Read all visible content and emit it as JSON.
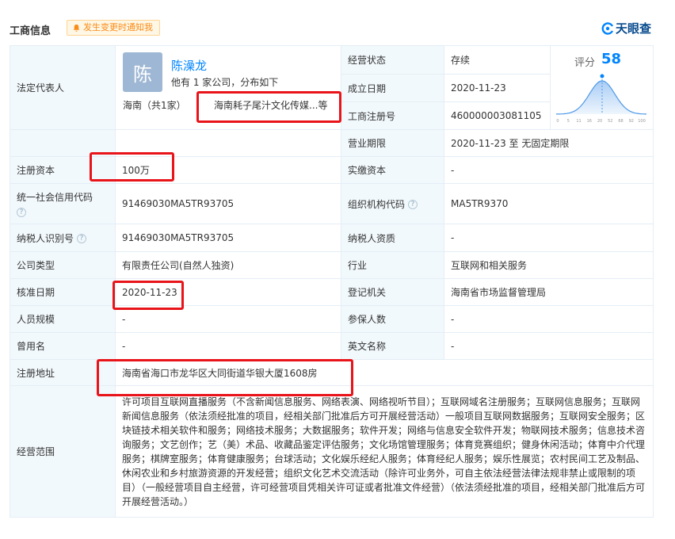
{
  "header": {
    "title": "工商信息",
    "notify_label": "发生变更时通知我",
    "brand_name": "天眼查"
  },
  "legal_rep": {
    "label": "法定代表人",
    "avatar_char": "陈",
    "name": "陈澡龙",
    "companies_text": "他有 1 家公司，分布如下",
    "region_text": "海南（共1家）",
    "company_text": "海南耗子尾汁文化传媒...等"
  },
  "score": {
    "label": "评分",
    "value": 58,
    "axis_ticks": [
      "0",
      "5",
      "11",
      "16",
      "20",
      "52",
      "68",
      "92",
      "100"
    ]
  },
  "fields": {
    "status_label": "经营状态",
    "status_value": "存续",
    "founded_label": "成立日期",
    "founded_value": "2020-11-23",
    "regno_label": "工商注册号",
    "regno_value": "460000003081105",
    "term_label": "营业期限",
    "term_value": "2020-11-23 至 无固定期限",
    "capital_label": "注册资本",
    "capital_value": "100万",
    "paidin_label": "实缴资本",
    "paidin_value": "-",
    "credit_label": "统一社会信用代码",
    "credit_value": "91469030MA5TR93705",
    "orgcode_label": "组织机构代码",
    "orgcode_value": "MA5TR9370",
    "taxid_label": "纳税人识别号",
    "taxid_value": "91469030MA5TR93705",
    "taxqual_label": "纳税人资质",
    "taxqual_value": "-",
    "type_label": "公司类型",
    "type_value": "有限责任公司(自然人独资)",
    "industry_label": "行业",
    "industry_value": "互联网和相关服务",
    "approval_label": "核准日期",
    "approval_value": "2020-11-23",
    "authority_label": "登记机关",
    "authority_value": "海南省市场监督管理局",
    "staff_label": "人员规模",
    "staff_value": "-",
    "insured_label": "参保人数",
    "insured_value": "-",
    "former_label": "曾用名",
    "former_value": "-",
    "english_label": "英文名称",
    "english_value": "-",
    "address_label": "注册地址",
    "address_value": "海南省海口市龙华区大同街道华银大厦1608房",
    "scope_label": "经营范围",
    "scope_value": "许可项目互联网直播服务（不含新闻信息服务、网络表演、网络视听节目）；互联网域名注册服务；互联网信息服务；互联网新闻信息服务（依法须经批准的项目，经相关部门批准后方可开展经营活动）一般项目互联网数据服务；互联网安全服务；区块链技术相关软件和服务；网络技术服务；大数据服务；软件开发；网络与信息安全软件开发；物联网技术服务；信息技术咨询服务；文艺创作；艺（美）术品、收藏品鉴定评估服务；文化场馆管理服务；体育竞赛组织；健身休闲活动；体育中介代理服务；棋牌室服务；体育健康服务；台球活动；文化娱乐经纪人服务；体育经纪人服务；娱乐性展览；农村民间工艺及制品、休闲农业和乡村旅游资源的开发经营；组织文化艺术交流活动（除许可业务外，可自主依法经营法律法规非禁止或限制的项目）（一般经营项目自主经营，许可经营项目凭相关许可证或者批准文件经营）（依法须经批准的项目，经相关部门批准后方可开展经营活动。）"
  },
  "colors": {
    "accent": "#0084ff",
    "label_bg": "#f2f9fc",
    "border": "#e4eef6",
    "highlight": "#e8141a",
    "notify_text": "#fa8c16"
  }
}
